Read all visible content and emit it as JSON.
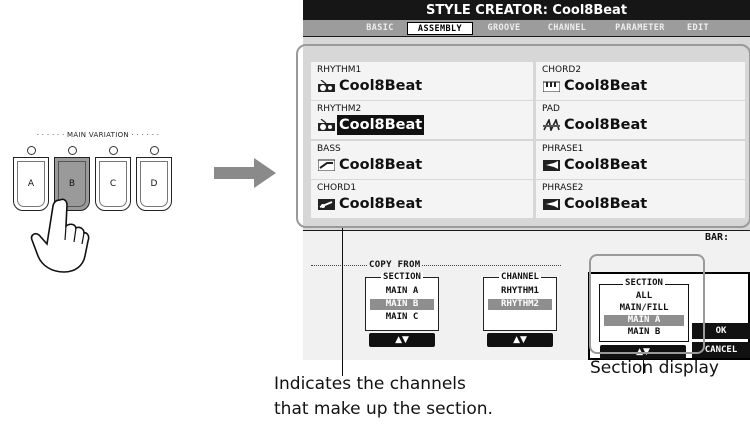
{
  "panel": {
    "main_variation_label": "· · · · · · MAIN VARIATION · · · · · ·",
    "buttons": [
      "A",
      "B",
      "C",
      "D"
    ],
    "selected_button": "B"
  },
  "screen": {
    "title": "STYLE CREATOR: Cool8Beat",
    "tabs": [
      "BASIC",
      "ASSEMBLY",
      "GROOVE",
      "CHANNEL",
      "PARAMETER",
      "EDIT"
    ],
    "active_tab": "ASSEMBLY",
    "channels": [
      {
        "name": "RHYTHM1",
        "style": "Cool8Beat",
        "icon": "drum-kit-icon"
      },
      {
        "name": "CHORD2",
        "style": "Cool8Beat",
        "icon": "keyboard-icon"
      },
      {
        "name": "RHYTHM2",
        "style": "Cool8Beat",
        "icon": "drum-kit-icon",
        "highlighted": true
      },
      {
        "name": "PAD",
        "style": "Cool8Beat",
        "icon": "strings-icon"
      },
      {
        "name": "BASS",
        "style": "Cool8Beat",
        "icon": "bass-icon"
      },
      {
        "name": "PHRASE1",
        "style": "Cool8Beat",
        "icon": "brass-icon"
      },
      {
        "name": "CHORD1",
        "style": "Cool8Beat",
        "icon": "guitar-icon"
      },
      {
        "name": "PHRASE2",
        "style": "Cool8Beat",
        "icon": "brass-icon"
      }
    ],
    "bar_label": "BAR:",
    "copy_from_label": "COPY FROM",
    "copy_section": {
      "header": "SECTION",
      "items": [
        "MAIN A",
        "MAIN B",
        "MAIN C"
      ],
      "selected": "MAIN B",
      "arrows": "▲▼"
    },
    "copy_channel": {
      "header": "CHANNEL",
      "items": [
        "RHYTHM1",
        "RHYTHM2"
      ],
      "selected": "RHYTHM2",
      "arrows": "▲▼"
    },
    "section_dialog": {
      "header": "SECTION",
      "items": [
        "ALL",
        "MAIN/FILL",
        "MAIN A",
        "MAIN B"
      ],
      "selected": "MAIN A",
      "arrows": "▲▼",
      "ok_label": "OK",
      "cancel_label": "CANCEL"
    }
  },
  "captions": {
    "channels_line1": "Indicates the channels",
    "channels_line2": "that make up the section.",
    "section_display": "Section display"
  },
  "colors": {
    "screen_dark": "#161616",
    "tab_strip": "#9c9c9c",
    "callout": "#9a9a9a",
    "arrow": "#8a8a8a"
  }
}
